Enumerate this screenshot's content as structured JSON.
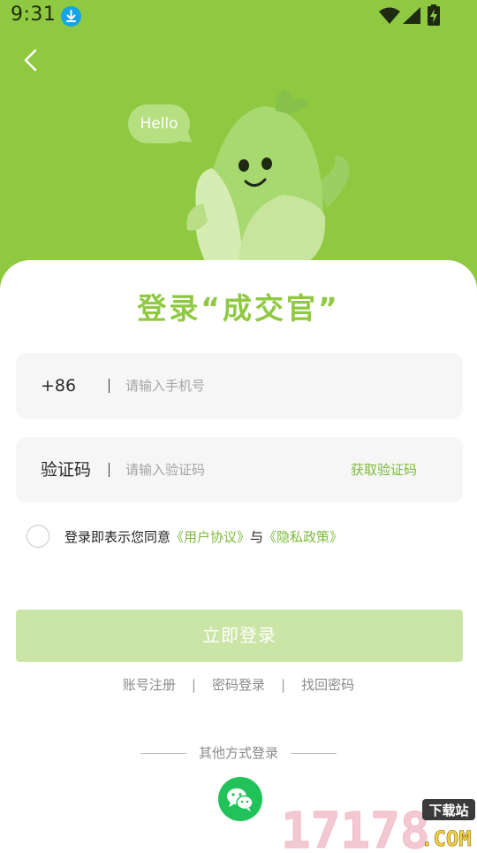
{
  "status_bar": {
    "time": "9:31",
    "download_icon": "download-notification-icon",
    "wifi_icon": "wifi-icon",
    "signal_icon": "signal-icon",
    "battery_icon": "battery-charging-icon"
  },
  "header": {
    "back_icon": "chevron-left-icon",
    "bubble_text": "Hello",
    "mascot": "green-vegetable-mascot"
  },
  "title": "登录“成交官”",
  "phone": {
    "prefix": "+86",
    "placeholder": "请输入手机号",
    "value": ""
  },
  "code": {
    "label": "验证码",
    "placeholder": "请输入验证码",
    "value": "",
    "get_code_label": "获取验证码"
  },
  "agreement": {
    "text_prefix": "登录即表示您同意",
    "user_agreement": "《用户协议》",
    "conjunction": "与",
    "privacy_policy": "《隐私政策》",
    "checked": false
  },
  "login_button": {
    "label": "立即登录"
  },
  "links": {
    "register": "账号注册",
    "separator": "|",
    "password_login": "密码登录",
    "find_password": "找回密码"
  },
  "other_login": {
    "label": "其他方式登录",
    "wechat_icon": "wechat-icon"
  },
  "watermark": {
    "number": "17178",
    "site_label": "下载站",
    "suffix": ".COM"
  },
  "colors": {
    "brand_green": "#8fc941",
    "link_green": "#7cbb3a",
    "button_disabled": "#cae5a6",
    "wechat_green": "#22c25b"
  }
}
